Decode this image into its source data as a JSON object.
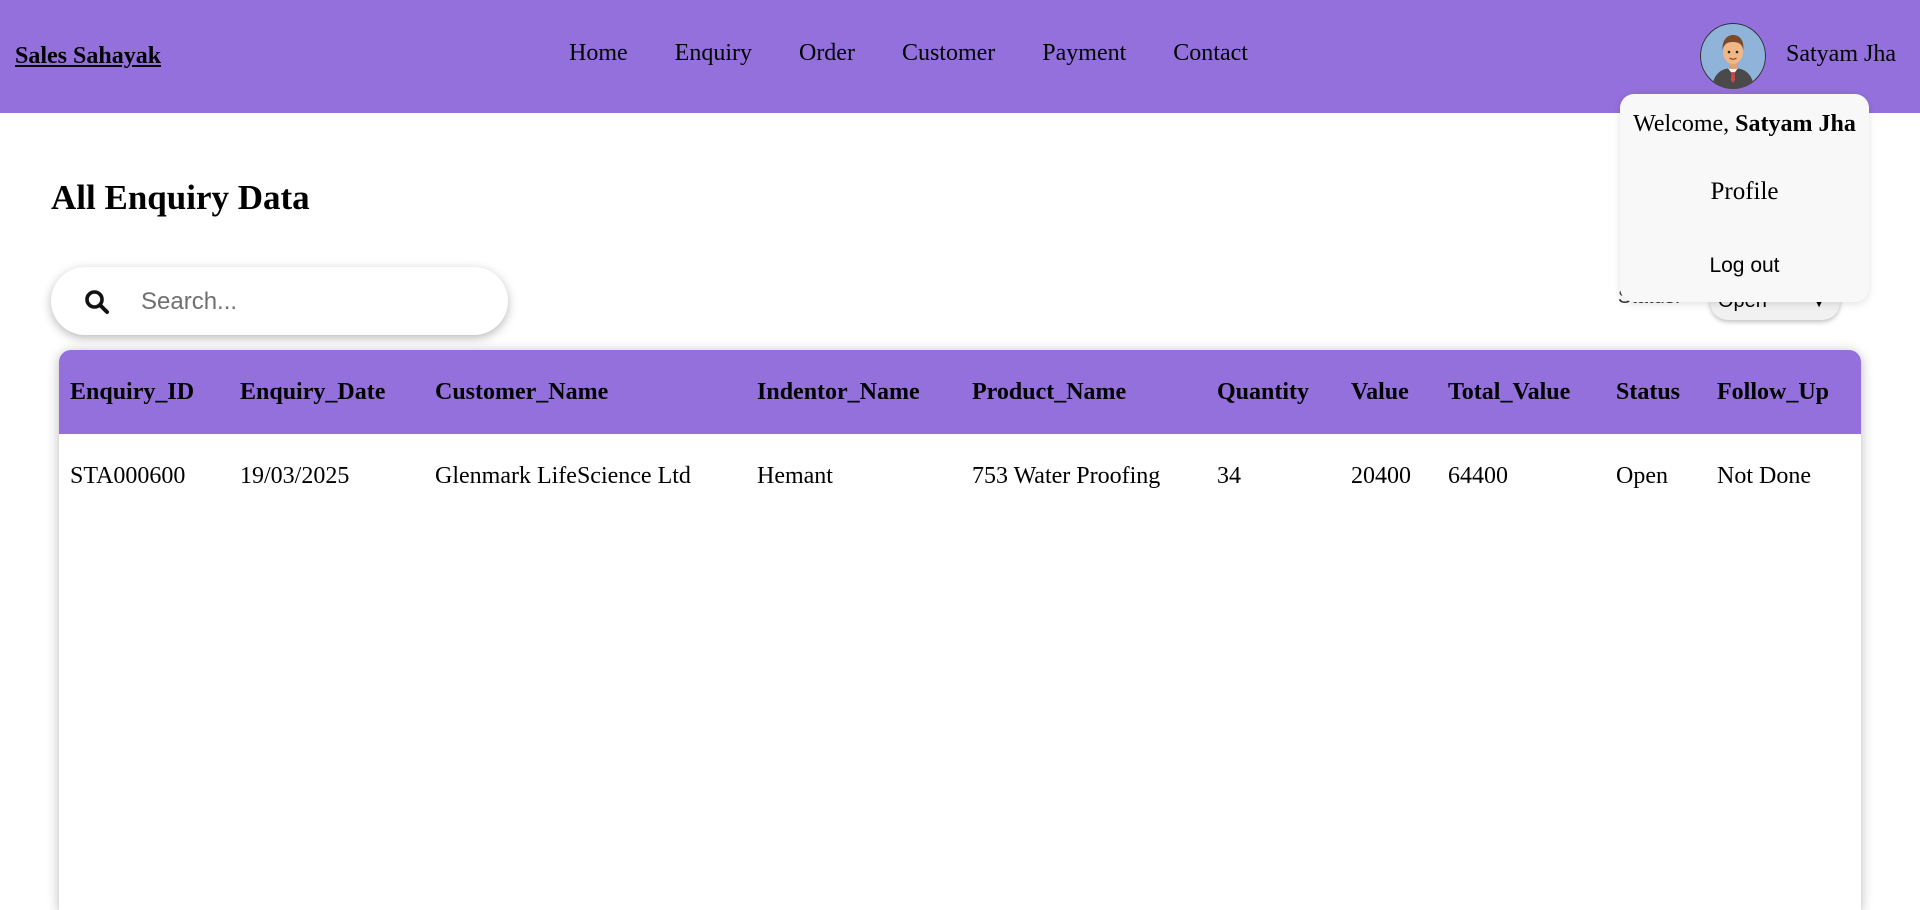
{
  "navbar": {
    "brand": "Sales Sahayak",
    "links": [
      "Home",
      "Enquiry",
      "Order",
      "Customer",
      "Payment",
      "Contact"
    ],
    "user_name": "Satyam Jha"
  },
  "user_menu": {
    "welcome_prefix": "Welcome, ",
    "welcome_name": "Satyam Jha",
    "profile": "Profile",
    "logout": "Log out"
  },
  "page": {
    "title": "All Enquiry Data"
  },
  "search": {
    "placeholder": "Search...",
    "value": "",
    "icon": "search-icon"
  },
  "filter": {
    "label": "Status:",
    "selected": "Open"
  },
  "table": {
    "columns": [
      "Enquiry_ID",
      "Enquiry_Date",
      "Customer_Name",
      "Indentor_Name",
      "Product_Name",
      "Quantity",
      "Value",
      "Total_Value",
      "Status",
      "Follow_Up"
    ],
    "rows": [
      [
        "STA000600",
        "19/03/2025",
        "Glenmark LifeScience Ltd",
        "Hemant",
        "753 Water Proofing",
        "34",
        "20400",
        "64400",
        "Open",
        "Not Done"
      ]
    ]
  },
  "colors": {
    "primary": "#9370db",
    "background": "#ffffff",
    "dropdown_bg": "#f8f8f8"
  }
}
